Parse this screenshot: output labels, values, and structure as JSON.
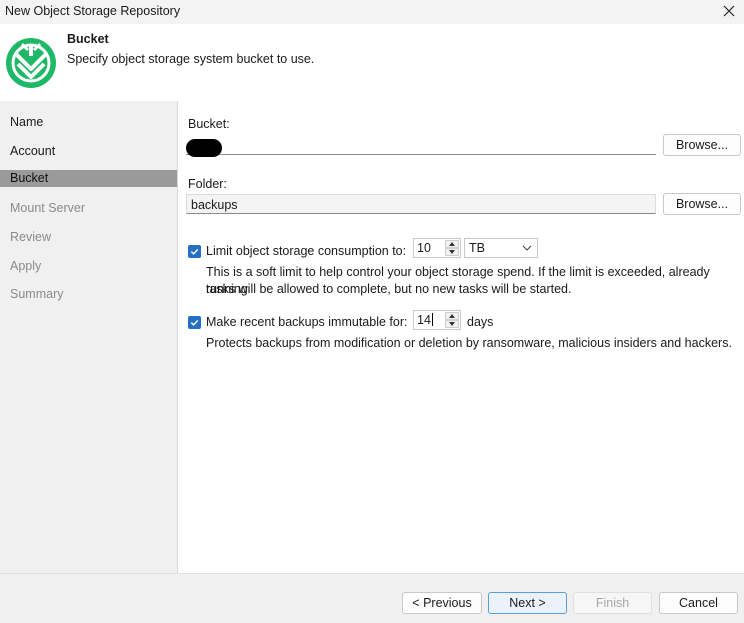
{
  "window": {
    "title": "New Object Storage Repository"
  },
  "header": {
    "title": "Bucket",
    "subtitle": "Specify object storage system bucket to use."
  },
  "sidebar": {
    "items": [
      {
        "label": "Name",
        "state": "normal"
      },
      {
        "label": "Account",
        "state": "normal"
      },
      {
        "label": "Bucket",
        "state": "active"
      },
      {
        "label": "Mount Server",
        "state": "disabled"
      },
      {
        "label": "Review",
        "state": "disabled"
      },
      {
        "label": "Apply",
        "state": "disabled"
      },
      {
        "label": "Summary",
        "state": "disabled"
      }
    ]
  },
  "bucket": {
    "label": "Bucket:",
    "value": "",
    "browse_label": "Browse..."
  },
  "folder": {
    "label": "Folder:",
    "value": "backups",
    "browse_label": "Browse..."
  },
  "limit": {
    "checked": true,
    "label": "Limit object storage consumption to:",
    "value": "10",
    "unit": "TB",
    "desc_line1": "This is a soft limit to help control your object storage spend. If the limit is exceeded, already running",
    "desc_line2": "tasks will be allowed to complete, but no new tasks will be started."
  },
  "immutable": {
    "checked": true,
    "label": "Make recent backups immutable for:",
    "value": "14",
    "unit": "days",
    "desc": "Protects backups from modification or deletion by ransomware, malicious insiders and hackers."
  },
  "footer": {
    "previous_label": "< Previous",
    "next_label": "Next >",
    "finish_label": "Finish",
    "cancel_label": "Cancel"
  },
  "colors": {
    "accent": "#2670c4",
    "logo": "#1fb866",
    "active_item": "#9a9a9a"
  }
}
